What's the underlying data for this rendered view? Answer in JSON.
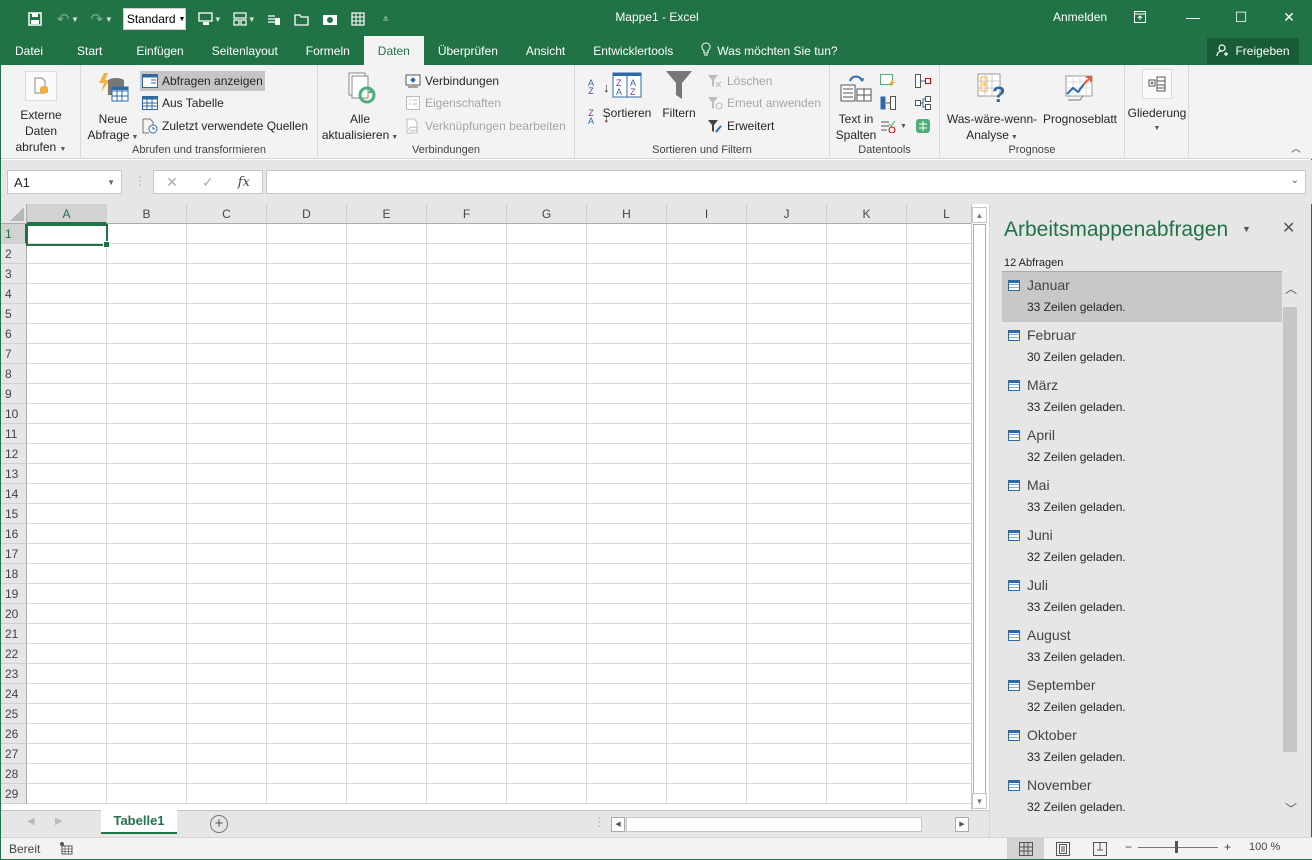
{
  "titlebar": {
    "title": "Mappe1  -  Excel",
    "signin": "Anmelden",
    "number_format": "Standard",
    "qat_icons": [
      "save-icon",
      "undo-icon",
      "redo-icon",
      "number-format-dropdown",
      "screen-icon",
      "layout-icon",
      "paste-icon",
      "open-folder-icon",
      "camera-icon",
      "table-icon",
      "customize-icon"
    ]
  },
  "tabs": [
    {
      "label": "Datei"
    },
    {
      "label": "Start"
    },
    {
      "label": "Einfügen"
    },
    {
      "label": "Seitenlayout"
    },
    {
      "label": "Formeln"
    },
    {
      "label": "Daten",
      "active": true
    },
    {
      "label": "Überprüfen"
    },
    {
      "label": "Ansicht"
    },
    {
      "label": "Entwicklertools"
    }
  ],
  "tellme": "Was möchten Sie tun?",
  "share": "Freigeben",
  "ribbon": {
    "groups": {
      "abrufen": "Abrufen und transformieren",
      "verbindungen": "Verbindungen",
      "sortieren": "Sortieren und Filtern",
      "datentools": "Datentools",
      "prognose": "Prognose"
    },
    "externe_daten": [
      "Externe Daten",
      "abrufen"
    ],
    "neue_abfrage": [
      "Neue",
      "Abfrage"
    ],
    "abfragen_anzeigen": "Abfragen anzeigen",
    "aus_tabelle": "Aus Tabelle",
    "zuletzt": "Zuletzt verwendete Quellen",
    "alle_aktualisieren": [
      "Alle",
      "aktualisieren"
    ],
    "verbindungen": "Verbindungen",
    "eigenschaften": "Eigenschaften",
    "verknuepfungen": "Verknüpfungen bearbeiten",
    "sortieren": "Sortieren",
    "filtern": "Filtern",
    "loeschen": "Löschen",
    "erneut": "Erneut anwenden",
    "erweitert": "Erweitert",
    "text_in_spalten": [
      "Text in",
      "Spalten"
    ],
    "was_waere": [
      "Was-wäre-wenn-",
      "Analyse"
    ],
    "prognoseblatt": "Prognoseblatt",
    "gliederung": "Gliederung"
  },
  "formula_bar": {
    "name_box": "A1",
    "formula": "",
    "fx": "fx"
  },
  "grid": {
    "columns": [
      "A",
      "B",
      "C",
      "D",
      "E",
      "F",
      "G",
      "H",
      "I",
      "J",
      "K",
      "L"
    ],
    "rows": [
      "1",
      "2",
      "3",
      "4",
      "5",
      "6",
      "7",
      "8",
      "9",
      "10",
      "11",
      "12",
      "13",
      "14",
      "15",
      "16",
      "17",
      "18",
      "19",
      "20",
      "21",
      "22",
      "23",
      "24",
      "25",
      "26",
      "27",
      "28",
      "29"
    ],
    "selected_cell": "A1"
  },
  "sheets": [
    {
      "label": "Tabelle1",
      "active": true
    }
  ],
  "status": {
    "ready": "Bereit",
    "zoom": "100 %",
    "zoom_level": 100
  },
  "pane": {
    "title": "Arbeitsmappenabfragen",
    "count": "12 Abfragen",
    "queries": [
      {
        "name": "Januar",
        "status": "33 Zeilen geladen.",
        "selected": true
      },
      {
        "name": "Februar",
        "status": "30 Zeilen geladen."
      },
      {
        "name": "März",
        "status": "33 Zeilen geladen."
      },
      {
        "name": "April",
        "status": "32 Zeilen geladen."
      },
      {
        "name": "Mai",
        "status": "33 Zeilen geladen."
      },
      {
        "name": "Juni",
        "status": "32 Zeilen geladen."
      },
      {
        "name": "Juli",
        "status": "33 Zeilen geladen."
      },
      {
        "name": "August",
        "status": "33 Zeilen geladen."
      },
      {
        "name": "September",
        "status": "32 Zeilen geladen."
      },
      {
        "name": "Oktober",
        "status": "33 Zeilen geladen."
      },
      {
        "name": "November",
        "status": "32 Zeilen geladen."
      }
    ]
  }
}
